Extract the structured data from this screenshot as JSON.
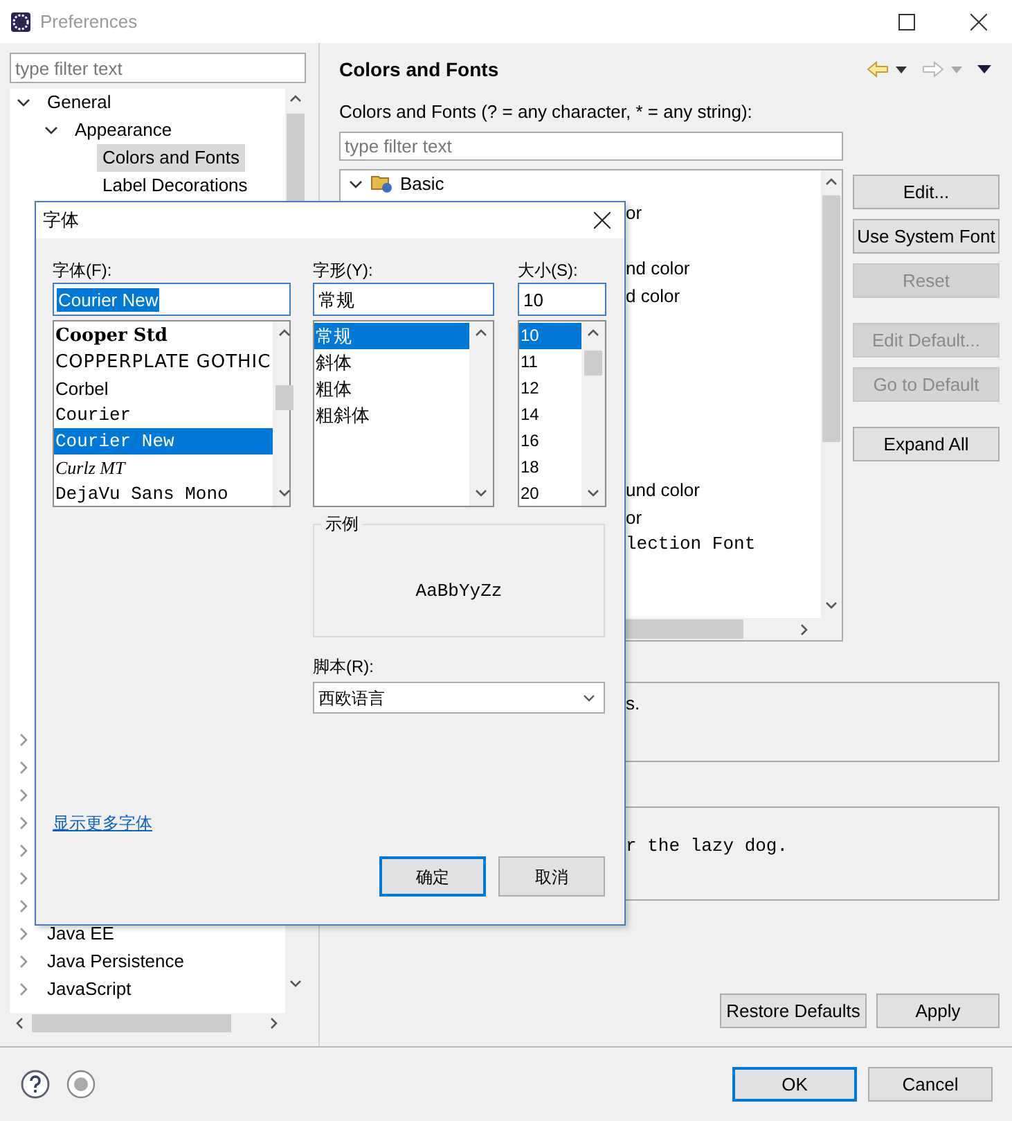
{
  "window": {
    "title": "Preferences"
  },
  "left": {
    "filter": {
      "placeholder": "type filter text"
    },
    "tree": [
      {
        "label": "General",
        "expanded": true,
        "selected": false,
        "children": [
          {
            "label": "Appearance",
            "expanded": true,
            "selected": false,
            "children": [
              {
                "label": "Colors and Fonts",
                "selected": true
              },
              {
                "label": "Label Decorations",
                "selected": false
              }
            ]
          }
        ]
      }
    ],
    "covered_rows": [
      {
        "expanded": false
      },
      {
        "expanded": false
      },
      {
        "expanded": false
      },
      {
        "expanded": false
      },
      {
        "expanded": false
      },
      {
        "expanded": false
      },
      {
        "expanded": false
      }
    ],
    "more_tree": [
      {
        "label": "Java EE",
        "expanded": false,
        "selected": false
      },
      {
        "label": "Java Persistence",
        "expanded": false,
        "selected": false
      },
      {
        "label": "JavaScript",
        "expanded": false,
        "selected": false
      }
    ]
  },
  "page": {
    "title": "Colors and Fonts",
    "filter_label": "Colors and Fonts (? = any character, * = any string):",
    "filter": {
      "placeholder": "type filter text"
    },
    "tree_root": {
      "label": "Basic",
      "expanded": true
    },
    "row_fragments": [
      {
        "text": "or",
        "kind": "plain"
      },
      {
        "text": "nd color",
        "kind": "plain"
      },
      {
        "text": "d color",
        "kind": "plain"
      },
      {
        "text": "und color",
        "kind": "plain"
      },
      {
        "text": "or",
        "kind": "plain"
      },
      {
        "text": "lection Font",
        "kind": "mono"
      }
    ],
    "buttons": [
      {
        "label": "Edit...",
        "disabled": false
      },
      {
        "label": "Use System Font",
        "disabled": false
      },
      {
        "label": "Reset",
        "disabled": true
      },
      {
        "label": "Edit Default...",
        "disabled": true
      },
      {
        "label": "Go to Default",
        "disabled": true
      },
      {
        "label": "Expand All",
        "disabled": false
      }
    ],
    "description_fragment": "s.",
    "preview_fragment": "r the lazy dog.",
    "footer_buttons": [
      "Restore Defaults",
      "Apply"
    ]
  },
  "dialog_buttons": [
    {
      "label": "OK",
      "default": true
    },
    {
      "label": "Cancel",
      "default": false
    }
  ],
  "font_dialog": {
    "title": "字体",
    "font": {
      "label": "字体(F):",
      "value": "Courier New",
      "items": [
        {
          "label": "Cooper Std",
          "kind": "blackserif",
          "selected": false
        },
        {
          "label": "COPPERPLATE GOTHIC",
          "kind": "wide",
          "selected": false
        },
        {
          "label": "Corbel",
          "kind": "sans",
          "selected": false
        },
        {
          "label": "Courier",
          "kind": "mono",
          "selected": false
        },
        {
          "label": "Courier New",
          "kind": "mono",
          "selected": true
        },
        {
          "label": "Curlz MT",
          "kind": "fancy",
          "selected": false
        },
        {
          "label": "DejaVu Sans Mono",
          "kind": "mono",
          "selected": false
        }
      ]
    },
    "style": {
      "label": "字形(Y):",
      "value": "常规",
      "items": [
        {
          "label": "常规",
          "selected": true
        },
        {
          "label": "斜体",
          "selected": false
        },
        {
          "label": "粗体",
          "selected": false
        },
        {
          "label": "粗斜体",
          "selected": false
        }
      ]
    },
    "size": {
      "label": "大小(S):",
      "value": "10",
      "items": [
        {
          "label": "10",
          "selected": true
        },
        {
          "label": "11",
          "selected": false
        },
        {
          "label": "12",
          "selected": false
        },
        {
          "label": "14",
          "selected": false
        },
        {
          "label": "16",
          "selected": false
        },
        {
          "label": "18",
          "selected": false
        },
        {
          "label": "20",
          "selected": false
        }
      ]
    },
    "sample": {
      "label": "示例",
      "text": "AaBbYyZz"
    },
    "script": {
      "label": "脚本(R):",
      "value": "西欧语言"
    },
    "more_fonts_link": "显示更多字体",
    "buttons": [
      {
        "label": "确定",
        "default": true
      },
      {
        "label": "取消",
        "default": false
      }
    ]
  }
}
